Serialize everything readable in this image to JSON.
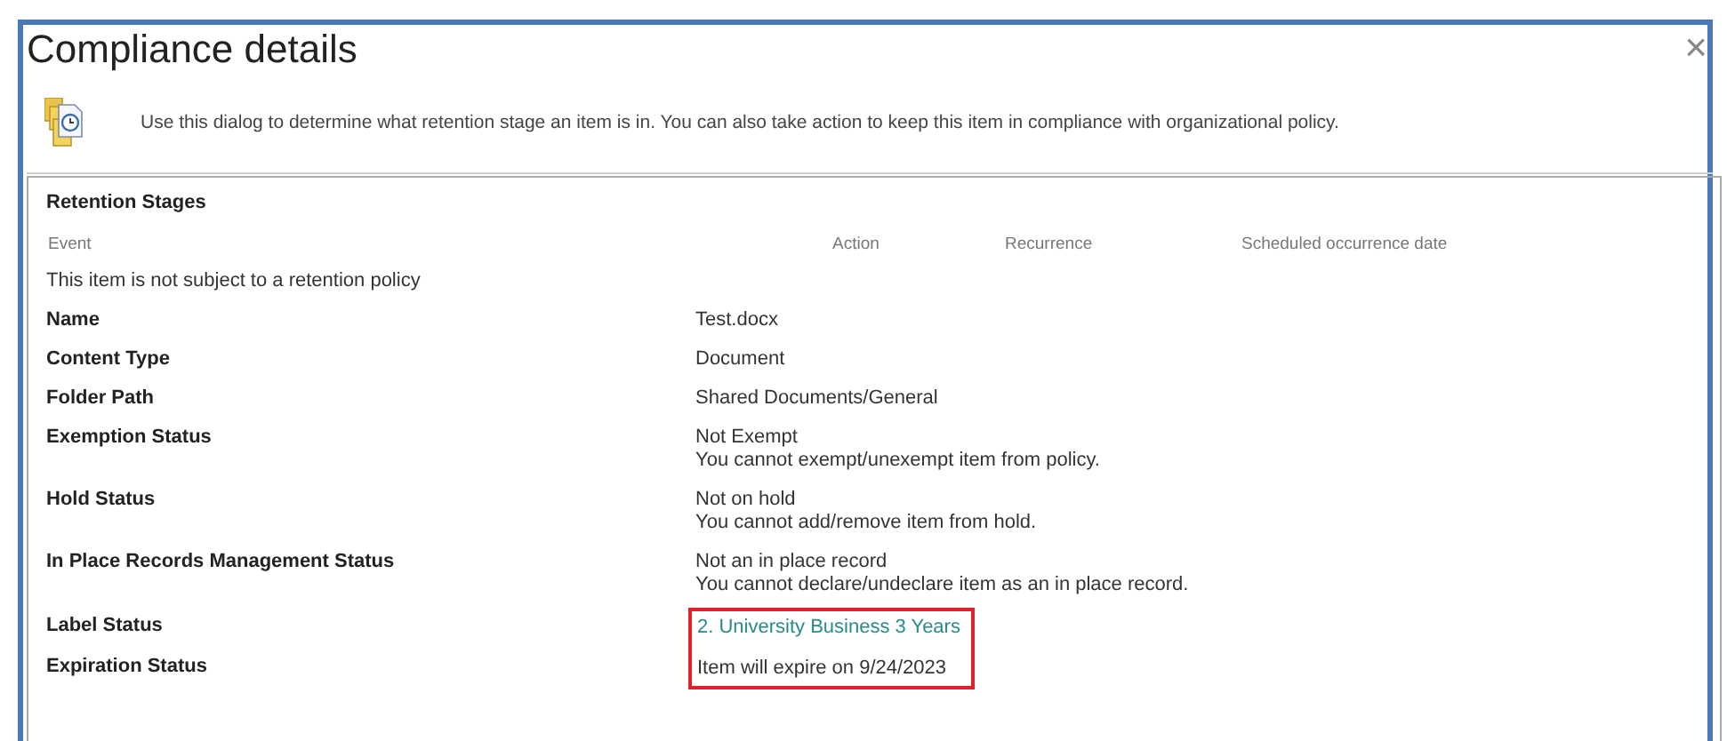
{
  "dialog": {
    "title": "Compliance details",
    "close": "×",
    "description": "Use this dialog to determine what retention stage an item is in. You can also take action to keep this item in compliance with organizational policy."
  },
  "retention": {
    "heading": "Retention Stages",
    "columns": [
      "Event",
      "Action",
      "Recurrence",
      "Scheduled occurrence date"
    ],
    "empty_message": "This item is not subject to a retention policy"
  },
  "details": [
    {
      "label": "Name",
      "value": "Test.docx"
    },
    {
      "label": "Content Type",
      "value": "Document"
    },
    {
      "label": "Folder Path",
      "value": "Shared Documents/General"
    },
    {
      "label": "Exemption Status",
      "value": "Not Exempt",
      "note": "You cannot exempt/unexempt item from policy."
    },
    {
      "label": "Hold Status",
      "value": "Not on hold",
      "note": "You cannot add/remove item from hold."
    },
    {
      "label": "In Place Records Management Status",
      "value": "Not an in place record",
      "note": "You cannot declare/undeclare item as an in place record."
    }
  ],
  "highlighted_details": [
    {
      "label": "Label Status",
      "value": "2. University Business 3 Years",
      "kind": "link"
    },
    {
      "label": "Expiration Status",
      "value": "Item will expire on 9/24/2023",
      "kind": "text"
    }
  ]
}
